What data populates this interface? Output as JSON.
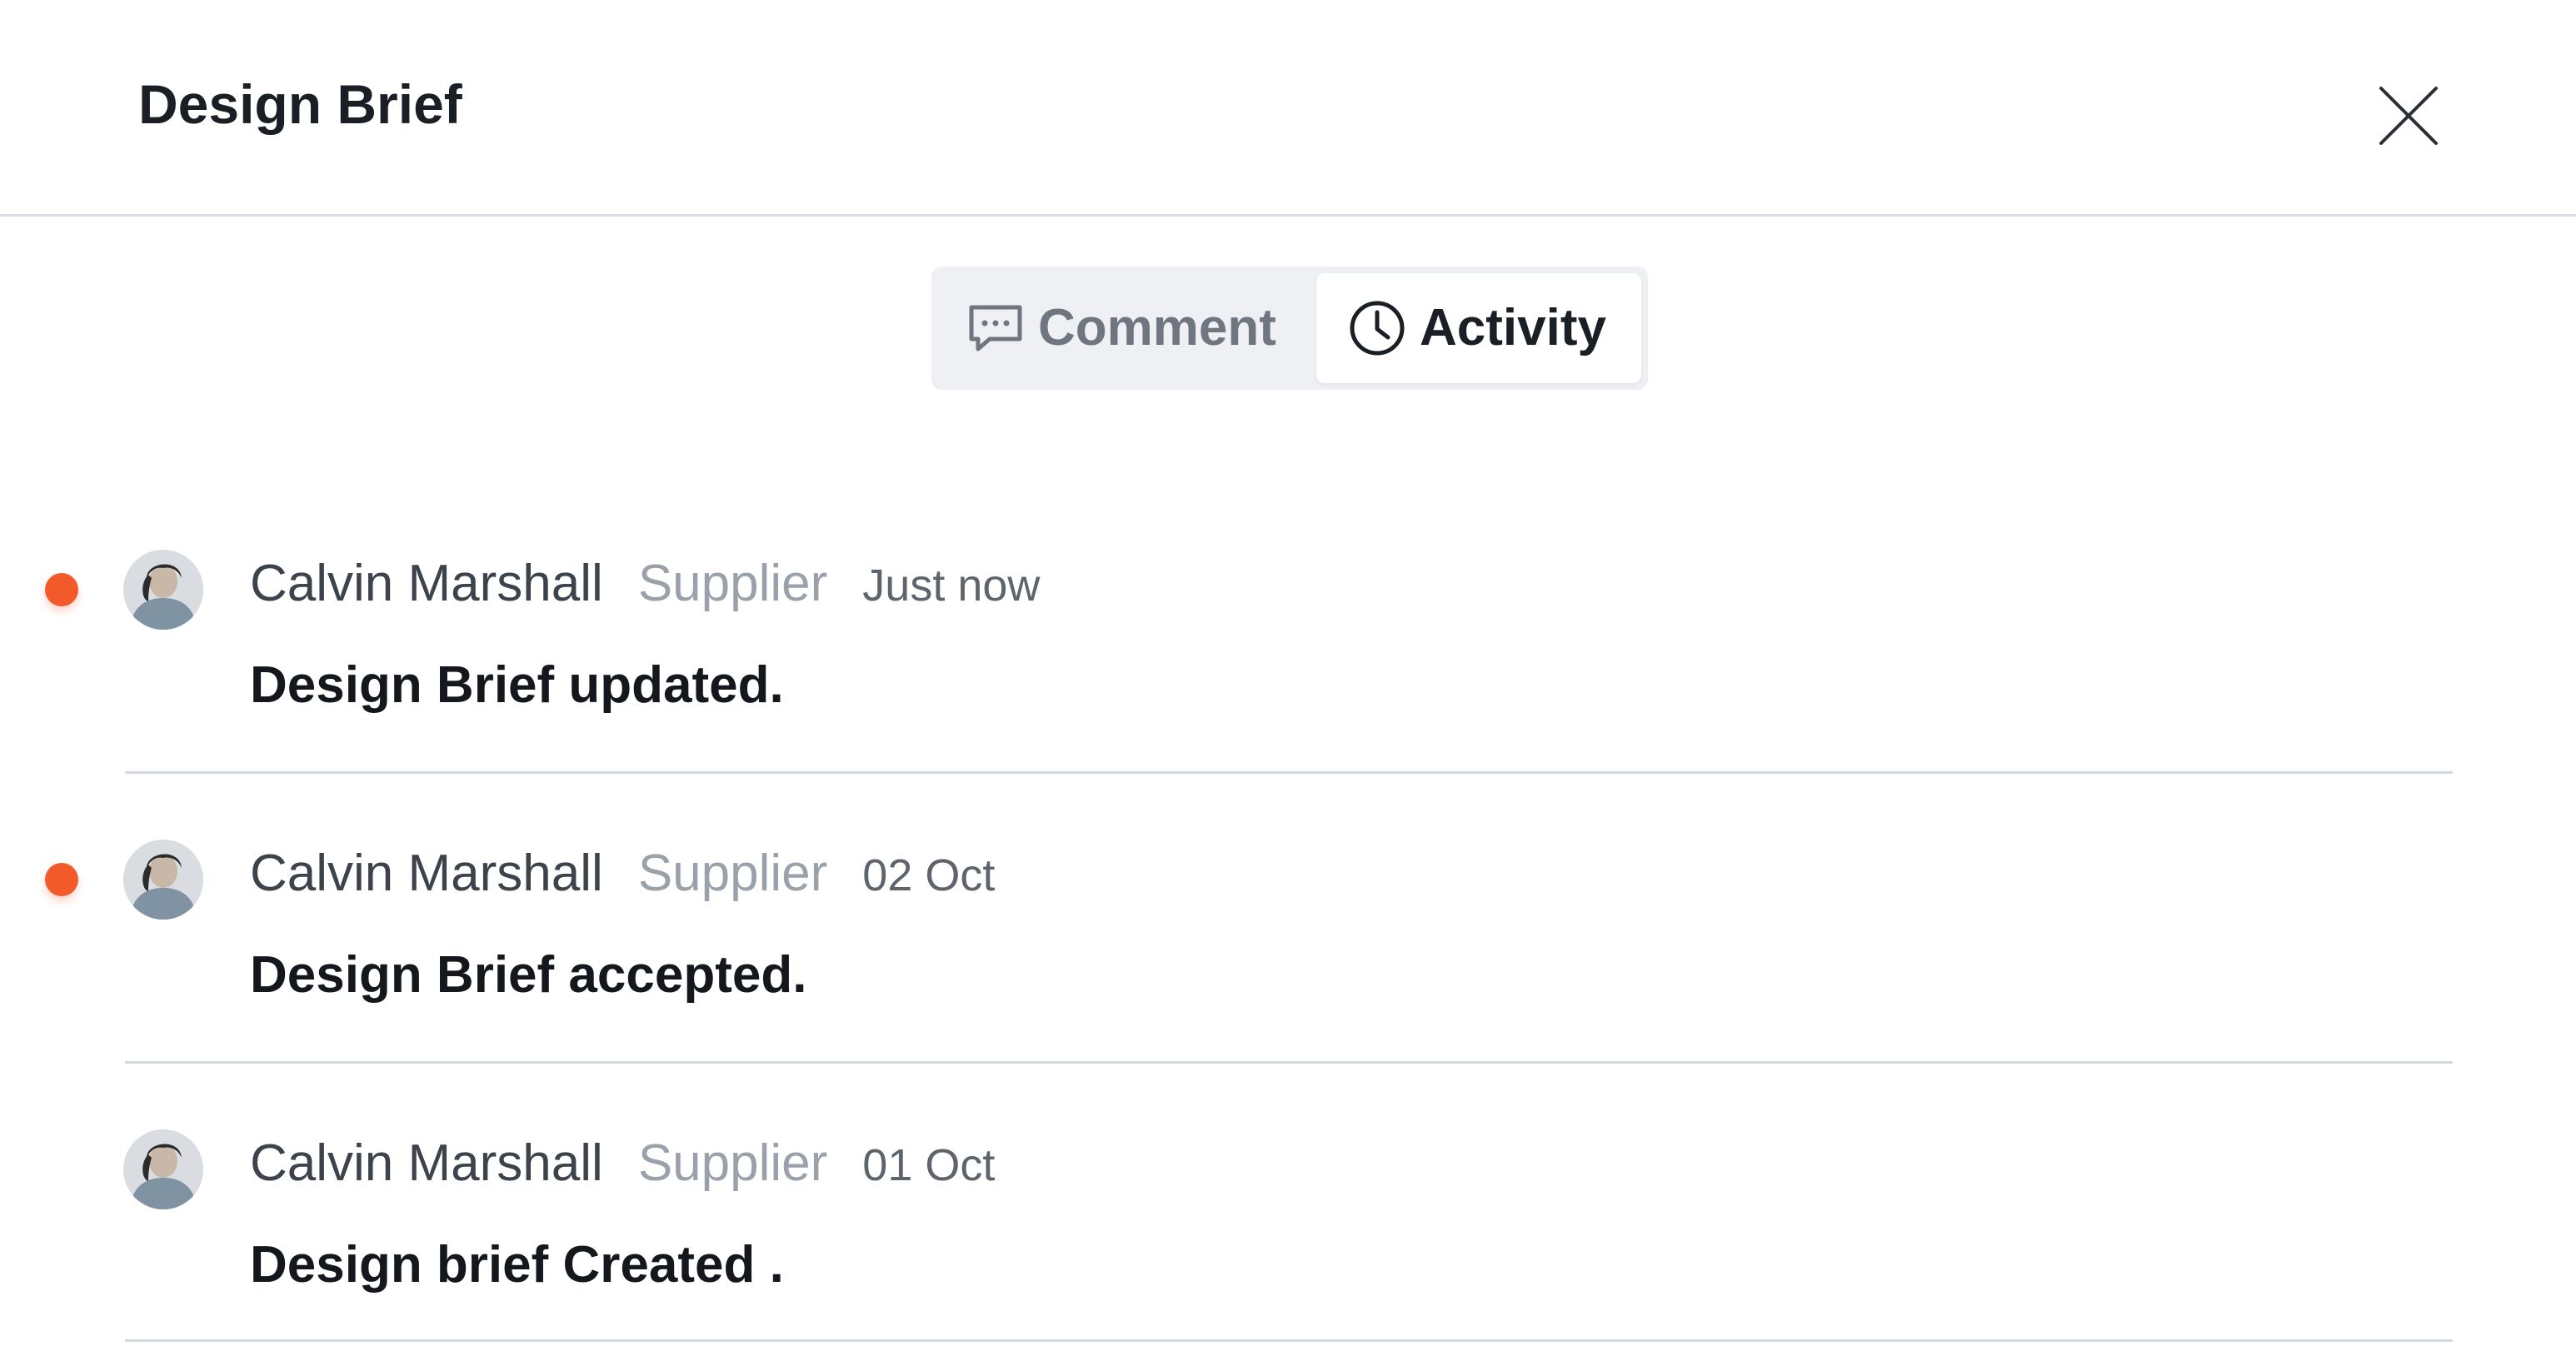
{
  "header": {
    "title": "Design Brief",
    "close_icon": "close-icon"
  },
  "tabs": [
    {
      "label": "Comment",
      "icon": "comment-icon",
      "active": false
    },
    {
      "label": "Activity",
      "icon": "clock-icon",
      "active": true
    }
  ],
  "activity": [
    {
      "name": "Calvin Marshall",
      "role": "Supplier",
      "time": "Just now",
      "message": "Design Brief updated.",
      "unread": true
    },
    {
      "name": "Calvin Marshall",
      "role": "Supplier",
      "time": "02 Oct",
      "message": "Design Brief accepted.",
      "unread": true
    },
    {
      "name": "Calvin Marshall",
      "role": "Supplier",
      "time": "01 Oct",
      "message": "Design brief Created .",
      "unread": false
    }
  ],
  "colors": {
    "unread_dot": "#f25a2b",
    "divider": "#d3d9e1",
    "tab_bg": "#eef0f4",
    "text_primary": "#14181d"
  }
}
